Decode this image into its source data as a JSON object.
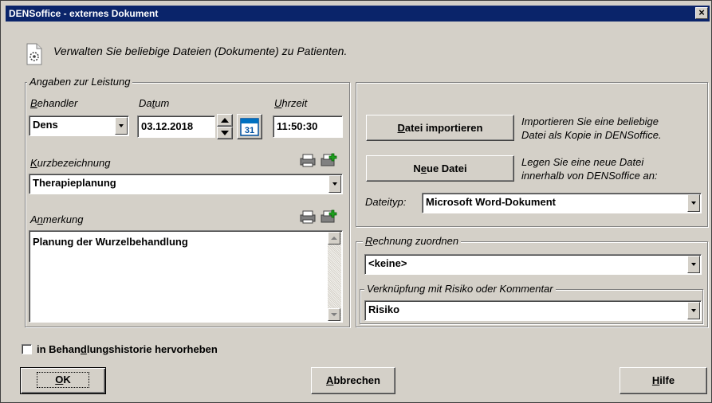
{
  "window": {
    "title": "DENSoffice - externes Dokument",
    "close_label": "×"
  },
  "header": {
    "description": "Verwalten Sie beliebige Dateien (Dokumente) zu Patienten.",
    "icon": "document-gear-icon"
  },
  "leistung": {
    "group_title": "Angaben zur Leistung",
    "behandler": {
      "label_pre": "",
      "label_ul": "B",
      "label_post": "ehandler",
      "value": "Dens"
    },
    "datum": {
      "label_pre": "Da",
      "label_ul": "t",
      "label_post": "um",
      "value": "03.12.2018"
    },
    "calendar_day": "31",
    "uhrzeit": {
      "label_pre": "",
      "label_ul": "U",
      "label_post": "hrzeit",
      "value": "11:50:30"
    },
    "kurzbezeichnung": {
      "label_pre": "",
      "label_ul": "K",
      "label_post": "urzbezeichnung",
      "value": "Therapieplanung"
    },
    "anmerkung": {
      "label_pre": "A",
      "label_ul": "n",
      "label_post": "merkung",
      "value": "Planung der Wurzelbehandlung"
    }
  },
  "datei": {
    "import_button": {
      "pre": "",
      "ul": "D",
      "post": "atei importieren"
    },
    "import_hint_1": "Importieren Sie eine beliebige",
    "import_hint_2": "Datei als Kopie in DENSoffice.",
    "new_button": {
      "pre": "N",
      "ul": "e",
      "post": "ue Datei"
    },
    "new_hint_1": "Legen Sie eine neue Datei",
    "new_hint_2": "innerhalb von DENSoffice an:",
    "dateityp_label": "Dateityp:",
    "dateityp_value": "Microsoft Word-Dokument"
  },
  "rechnung": {
    "group_title_pre": "",
    "group_title_ul": "R",
    "group_title_post": "echnung zuordnen",
    "value": "<keine>",
    "risiko_group_title": "Verknüpfung mit Risiko oder Kommentar",
    "risiko_value": "Risiko"
  },
  "footer": {
    "checkbox_label_pre": "in Behan",
    "checkbox_label_ul": "d",
    "checkbox_label_post": "lungshistorie hervorheben",
    "checkbox_checked": false,
    "ok": {
      "pre": "",
      "ul": "O",
      "post": "K"
    },
    "cancel": {
      "pre": "",
      "ul": "A",
      "post": "bbrechen"
    },
    "help": {
      "pre": "",
      "ul": "H",
      "post": "ilfe"
    }
  }
}
